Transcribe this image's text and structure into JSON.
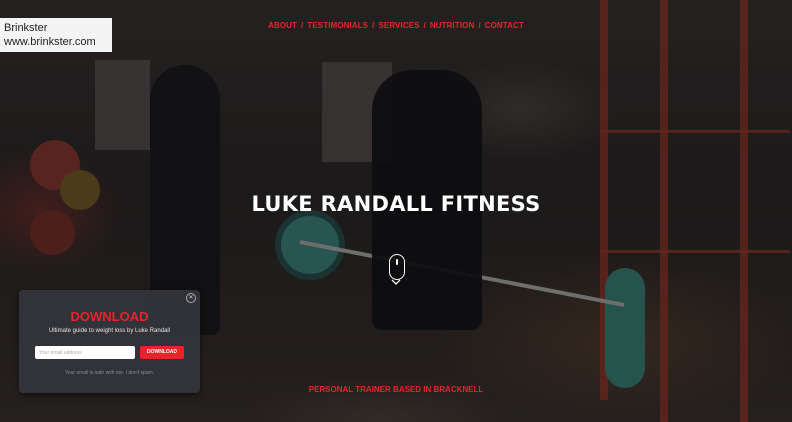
{
  "watermark": {
    "line1": "Brinkster",
    "line2": "www.brinkster.com"
  },
  "nav": {
    "items": [
      "ABOUT",
      "TESTIMONIALS",
      "SERVICES",
      "NUTRITION",
      "CONTACT"
    ],
    "separator": "/"
  },
  "hero": {
    "title": "LUKE RANDALL FITNESS",
    "tagline": "PERSONAL TRAINER BASED IN BRACKNELL"
  },
  "popup": {
    "close_icon": "close-icon",
    "heading": "DOWNLOAD",
    "subtitle": "Ultimate guide to weight loss by Luke Randall",
    "email_placeholder": "Your email address",
    "button_label": "DOWNLOAD",
    "note": "Your email is safe with me. I don't spam."
  },
  "colors": {
    "accent": "#e8242a",
    "popup_bg": "#34343c",
    "text": "#ffffff"
  },
  "icons": {
    "scroll": "mouse-scroll-icon"
  }
}
